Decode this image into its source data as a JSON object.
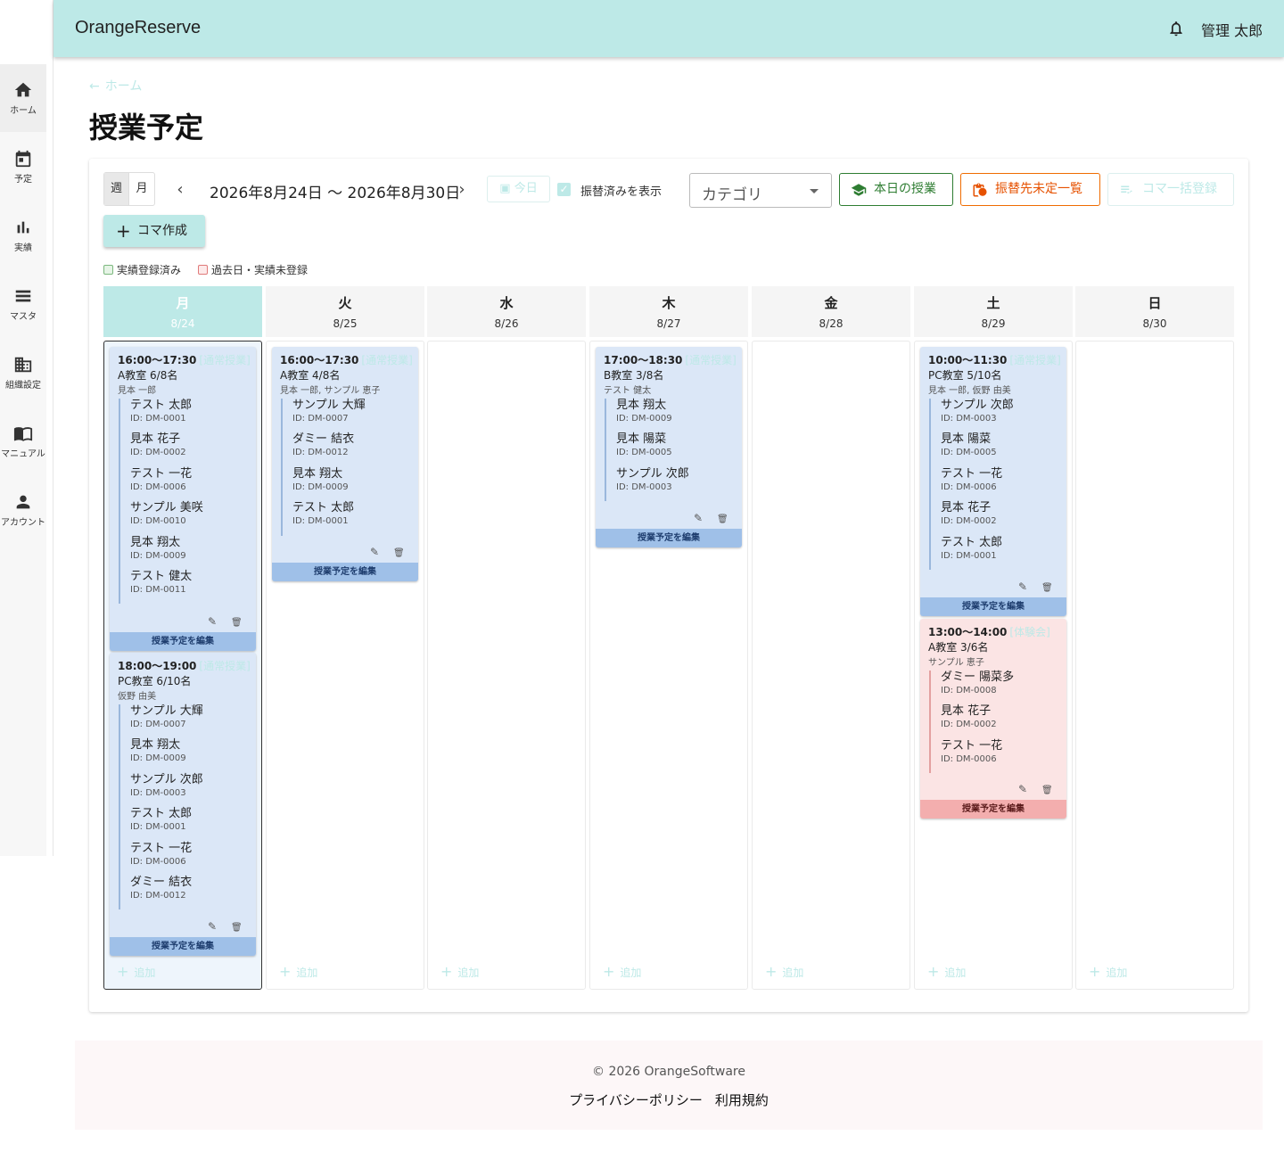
{
  "app": {
    "brand": "OrangeReserve",
    "user": "管理 太郎",
    "bell_icon": "bell-icon",
    "accent": "#bde9e7"
  },
  "sidebar": {
    "items": [
      {
        "label": "ホーム",
        "icon": "home-icon"
      },
      {
        "label": "予定",
        "icon": "calendar-icon"
      },
      {
        "label": "実績",
        "icon": "bar-chart-icon"
      },
      {
        "label": "マスタ",
        "icon": "list-icon"
      },
      {
        "label": "組織設定",
        "icon": "building-icon"
      },
      {
        "label": "マニュアル",
        "icon": "book-icon"
      },
      {
        "label": "アカウント",
        "icon": "person-icon"
      }
    ]
  },
  "breadcrumb": {
    "home": "ホーム"
  },
  "page": {
    "title": "授業予定"
  },
  "toolbar": {
    "week": "週",
    "month": "月",
    "range": "2026年8月24日 〜 2026年8月30日",
    "today": "今日",
    "show_transferred": "振替済みを表示",
    "category": "カテゴリ",
    "today_lessons": "本日の授業",
    "unassigned": "振替先未定一覧",
    "bulk": "コマ一括登録",
    "create": "コマ作成"
  },
  "legend": {
    "done": "実績登録済み",
    "pending": "過去日・実績未登録",
    "done_color": "#c8e6c9",
    "pending_color": "#fcdada"
  },
  "days": [
    {
      "dow": "月",
      "date": "8/24"
    },
    {
      "dow": "火",
      "date": "8/25"
    },
    {
      "dow": "水",
      "date": "8/26"
    },
    {
      "dow": "木",
      "date": "8/27"
    },
    {
      "dow": "金",
      "date": "8/28"
    },
    {
      "dow": "土",
      "date": "8/29"
    },
    {
      "dow": "日",
      "date": "8/30"
    }
  ],
  "add_label": "追加",
  "edit_label": "授業予定を編集",
  "lessons": {
    "mon1": {
      "time": "16:00〜17:30",
      "type": "[通常授業]",
      "room": "A教室 6/8名",
      "teacher": "見本 一郎",
      "students": [
        [
          "テスト 太郎",
          "ID: DM-0001"
        ],
        [
          "見本 花子",
          "ID: DM-0002"
        ],
        [
          "テスト 一花",
          "ID: DM-0006"
        ],
        [
          "サンプル 美咲",
          "ID: DM-0010"
        ],
        [
          "見本 翔太",
          "ID: DM-0009"
        ],
        [
          "テスト 健太",
          "ID: DM-0011"
        ]
      ]
    },
    "mon2": {
      "time": "18:00〜19:00",
      "type": "[通常授業]",
      "room": "PC教室 6/10名",
      "teacher": "仮野 由美",
      "students": [
        [
          "サンプル 大輝",
          "ID: DM-0007"
        ],
        [
          "見本 翔太",
          "ID: DM-0009"
        ],
        [
          "サンプル 次郎",
          "ID: DM-0003"
        ],
        [
          "テスト 太郎",
          "ID: DM-0001"
        ],
        [
          "テスト 一花",
          "ID: DM-0006"
        ],
        [
          "ダミー 結衣",
          "ID: DM-0012"
        ]
      ]
    },
    "tue1": {
      "time": "16:00〜17:30",
      "type": "[通常授業]",
      "room": "A教室 4/8名",
      "teacher": "見本 一郎, サンプル 恵子",
      "students": [
        [
          "サンプル 大輝",
          "ID: DM-0007"
        ],
        [
          "ダミー 結衣",
          "ID: DM-0012"
        ],
        [
          "見本 翔太",
          "ID: DM-0009"
        ],
        [
          "テスト 太郎",
          "ID: DM-0001"
        ]
      ]
    },
    "thu1": {
      "time": "17:00〜18:30",
      "type": "[通常授業]",
      "room": "B教室 3/8名",
      "teacher": "テスト 健太",
      "students": [
        [
          "見本 翔太",
          "ID: DM-0009"
        ],
        [
          "見本 陽菜",
          "ID: DM-0005"
        ],
        [
          "サンプル 次郎",
          "ID: DM-0003"
        ]
      ]
    },
    "sat1": {
      "time": "10:00〜11:30",
      "type": "[通常授業]",
      "room": "PC教室 5/10名",
      "teacher": "見本 一郎, 仮野 由美",
      "students": [
        [
          "サンプル 次郎",
          "ID: DM-0003"
        ],
        [
          "見本 陽菜",
          "ID: DM-0005"
        ],
        [
          "テスト 一花",
          "ID: DM-0006"
        ],
        [
          "見本 花子",
          "ID: DM-0002"
        ],
        [
          "テスト 太郎",
          "ID: DM-0001"
        ]
      ]
    },
    "sat2": {
      "time": "13:00〜14:00",
      "type": "[体験会]",
      "room": "A教室 3/6名",
      "teacher": "サンプル 恵子",
      "students": [
        [
          "ダミー 陽菜多",
          "ID: DM-0008"
        ],
        [
          "見本 花子",
          "ID: DM-0002"
        ],
        [
          "テスト 一花",
          "ID: DM-0006"
        ]
      ]
    }
  },
  "footer": {
    "copyright": "© 2026 OrangeSoftware",
    "privacy": "プライバシーポリシー",
    "terms": "利用規約"
  }
}
